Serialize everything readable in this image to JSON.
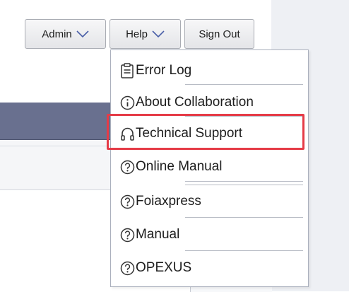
{
  "header": {
    "admin_label": "Admin",
    "help_label": "Help",
    "signout_label": "Sign Out"
  },
  "help_menu": {
    "items": [
      {
        "label": "Error Log",
        "icon": "clipboard-icon"
      },
      {
        "label": "About Collaboration",
        "icon": "info-icon"
      },
      {
        "label": "Technical Support",
        "icon": "headset-icon",
        "highlighted": true
      },
      {
        "label": "Online Manual",
        "icon": "question-icon"
      },
      {
        "label": "Foiaxpress",
        "icon": "question-icon"
      },
      {
        "label": "Manual",
        "icon": "question-icon"
      },
      {
        "label": "OPEXUS",
        "icon": "question-icon"
      }
    ]
  },
  "colors": {
    "highlight": "#e53b47",
    "stripe": "#69708f",
    "menu_border": "#aab0bd"
  }
}
